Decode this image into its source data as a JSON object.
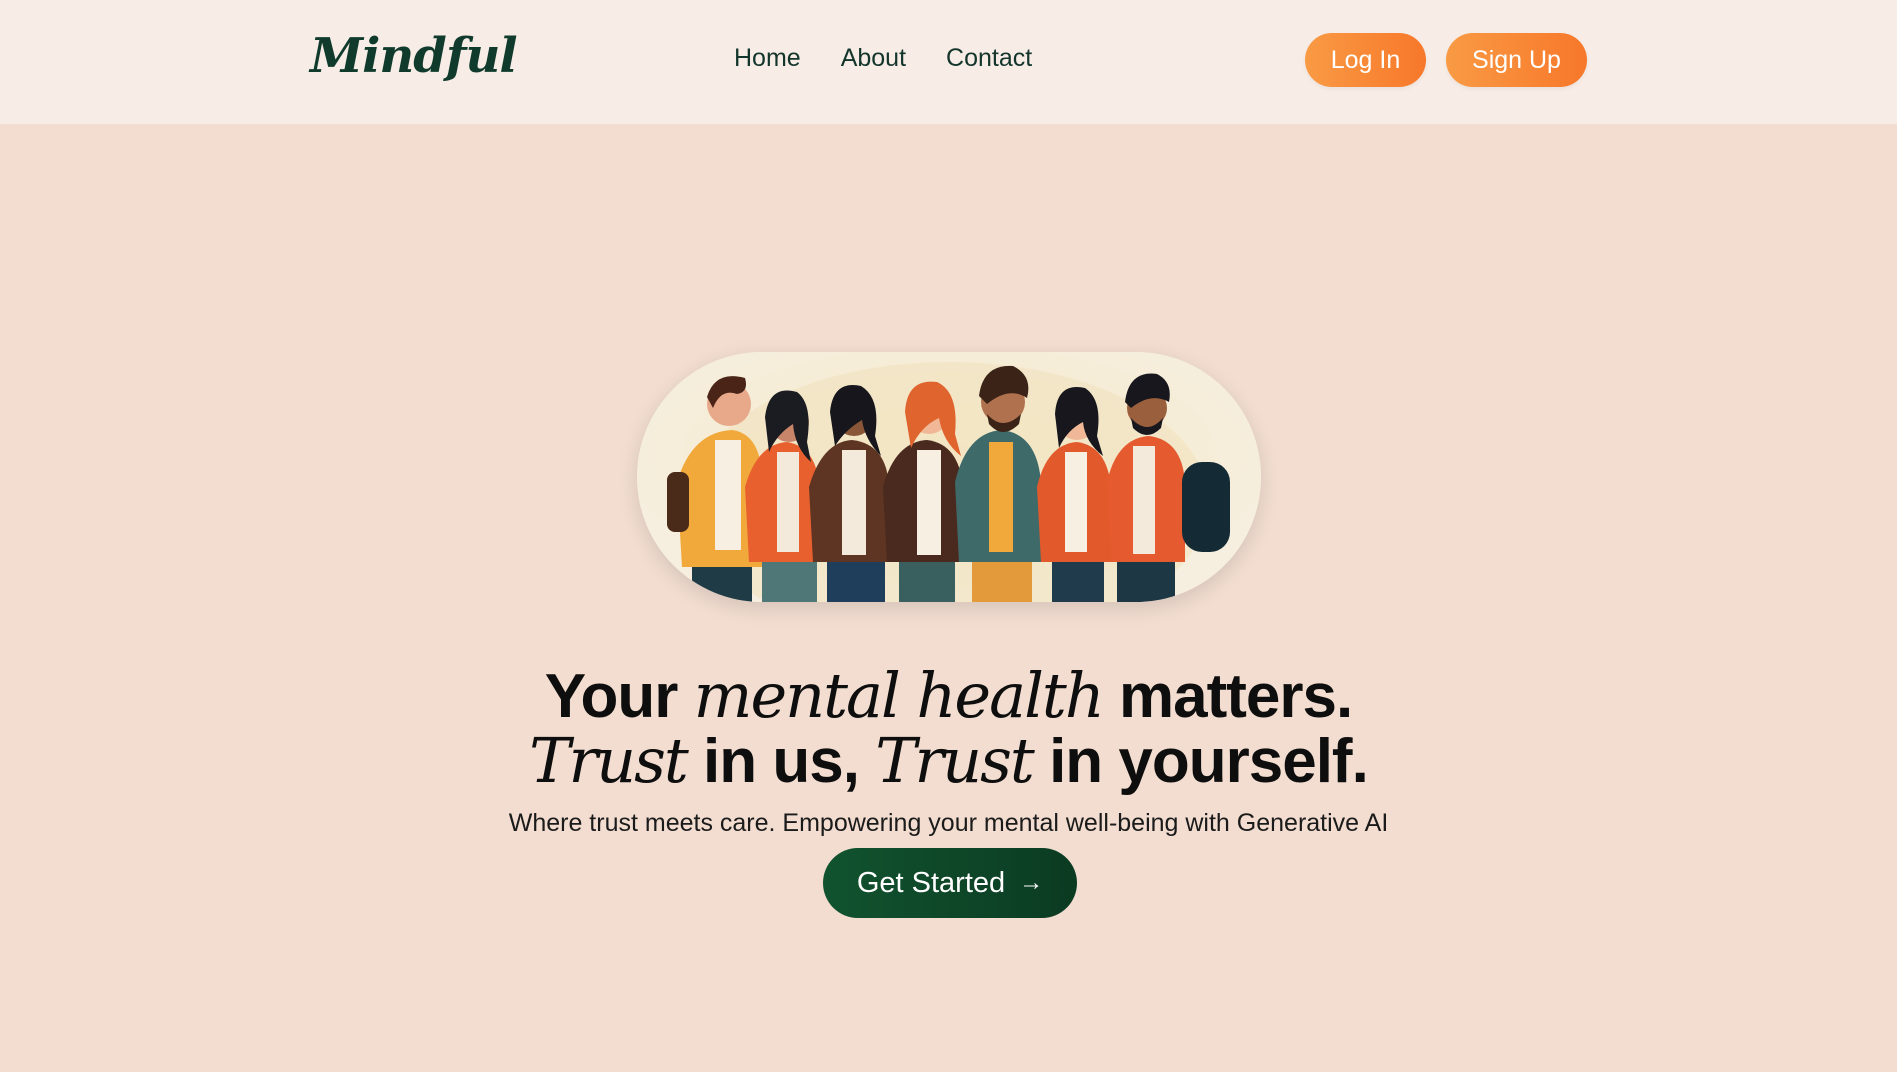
{
  "brand": {
    "logo_text": "Mindful"
  },
  "nav": {
    "links": [
      {
        "label": "Home"
      },
      {
        "label": "About"
      },
      {
        "label": "Contact"
      }
    ],
    "login_label": "Log In",
    "signup_label": "Sign Up"
  },
  "hero": {
    "image_name": "illustration of diverse group of people",
    "headline": {
      "line1_a": "Your ",
      "line1_em": "mental health",
      "line1_b": " matters.",
      "line2_em1": "Trust",
      "line2_a": " in us, ",
      "line2_em2": "Trust",
      "line2_b": " in yourself."
    },
    "subtitle": "Where trust meets care. Empowering your mental well-being with Generative AI",
    "cta_label": "Get Started",
    "cta_icon": "arrow-right-icon"
  },
  "colors": {
    "background": "#f2ddd0",
    "nav_background": "#f7ece6",
    "accent_orange": "#f7862f",
    "cta_green": "#0e4a2a",
    "logo_green": "#0f3a2c"
  }
}
